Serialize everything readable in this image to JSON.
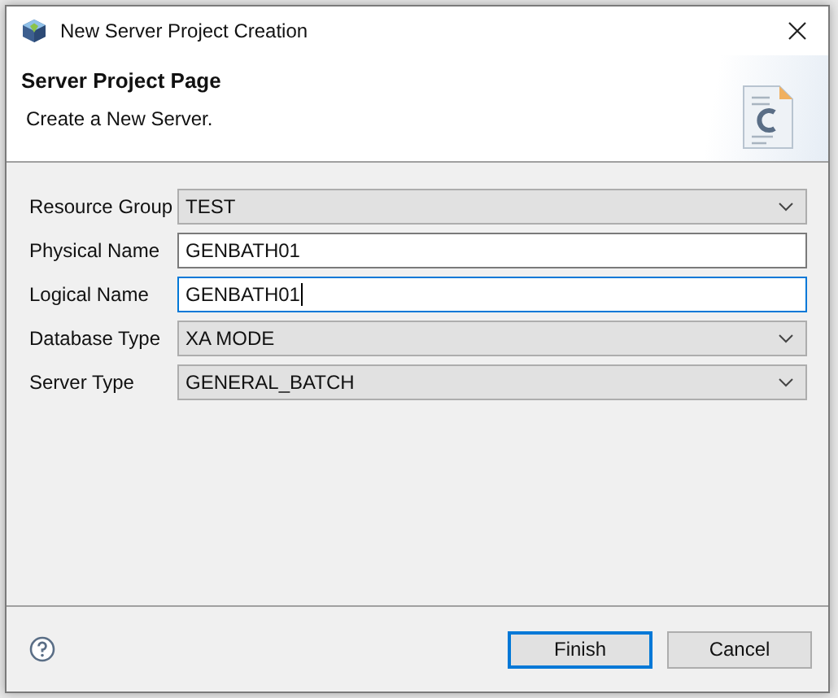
{
  "window": {
    "title": "New Server Project Creation"
  },
  "header": {
    "title": "Server Project Page",
    "description": "Create a New Server."
  },
  "fields": [
    {
      "label": "Resource Group",
      "kind": "dropdown",
      "value": "TEST",
      "focused": false
    },
    {
      "label": "Physical Name",
      "kind": "text",
      "value": "GENBATH01",
      "focused": false
    },
    {
      "label": "Logical Name",
      "kind": "text",
      "value": "GENBATH01",
      "focused": true
    },
    {
      "label": "Database Type",
      "kind": "dropdown",
      "value": "XA MODE",
      "focused": false
    },
    {
      "label": "Server Type",
      "kind": "dropdown",
      "value": "GENERAL_BATCH",
      "focused": false
    }
  ],
  "buttons": [
    {
      "label": "Finish",
      "default": true
    },
    {
      "label": "Cancel",
      "default": false
    }
  ]
}
